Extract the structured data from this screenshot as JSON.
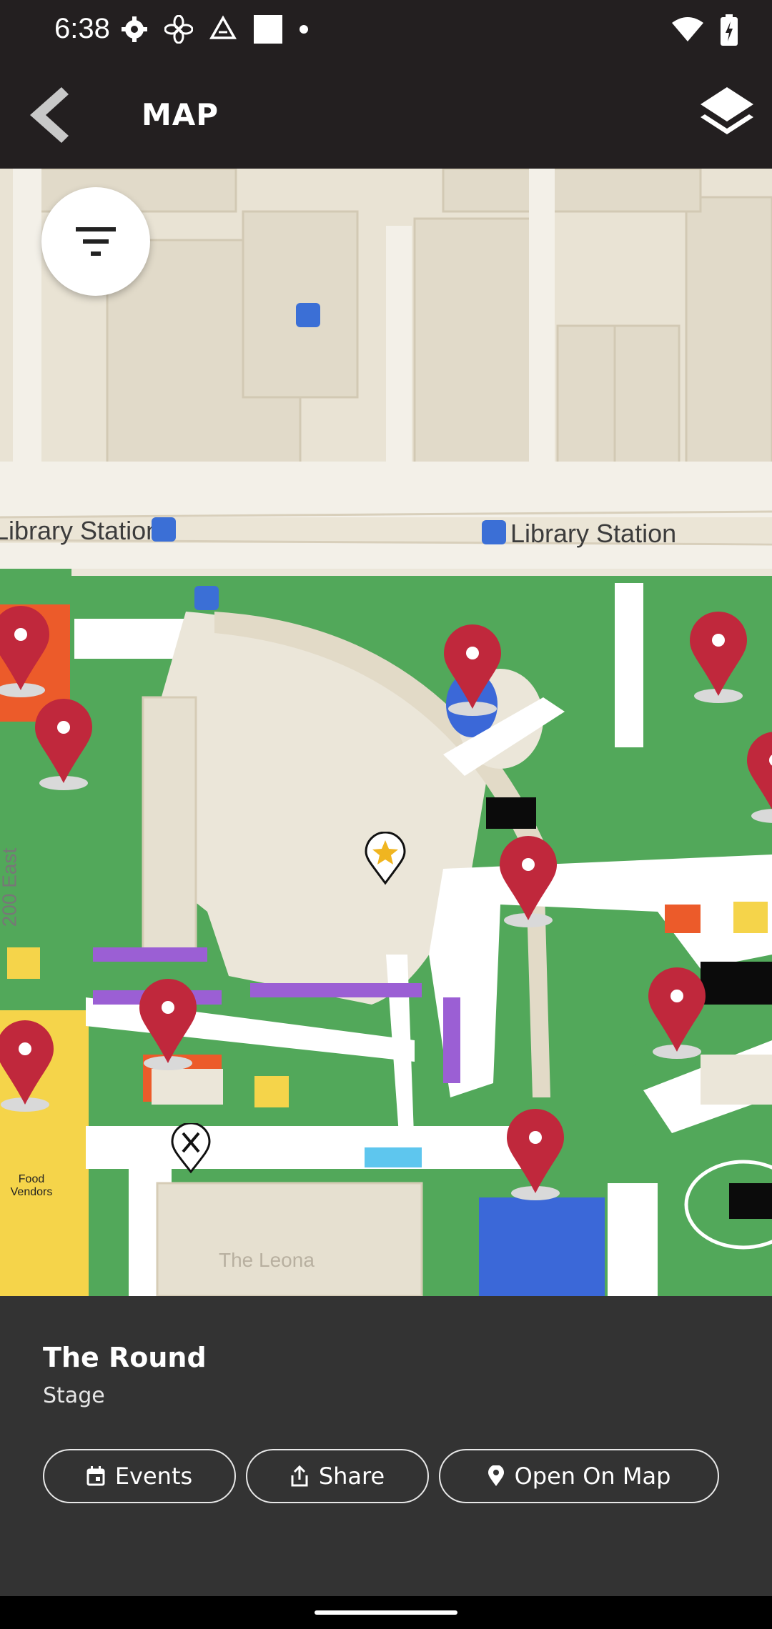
{
  "status_bar": {
    "time": "6:38",
    "icons_left": [
      "settings-icon",
      "fan-icon",
      "drive-icon",
      "square-icon",
      "dot-icon"
    ],
    "icons_right": [
      "wifi-icon",
      "battery-icon"
    ]
  },
  "app_bar": {
    "back_icon": "chevron-left-icon",
    "title": "MAP",
    "layers_icon": "layers-icon"
  },
  "map": {
    "filter_icon": "filter-icon",
    "stations": [
      "Library Station",
      "Library Station"
    ],
    "road_label": "200 East",
    "building_label": "The Leona",
    "food_label": "Food Vendors",
    "colors": {
      "land": "#ebe6d9",
      "park": "#52a85a",
      "pin": "#c0283c",
      "path": "#ffffff"
    }
  },
  "place": {
    "title": "The Round",
    "subtitle": "Stage"
  },
  "actions": [
    {
      "label": "Events",
      "icon": "calendar-icon"
    },
    {
      "label": "Share",
      "icon": "share-icon"
    },
    {
      "label": "Open On Map",
      "icon": "location-pin-icon"
    }
  ]
}
